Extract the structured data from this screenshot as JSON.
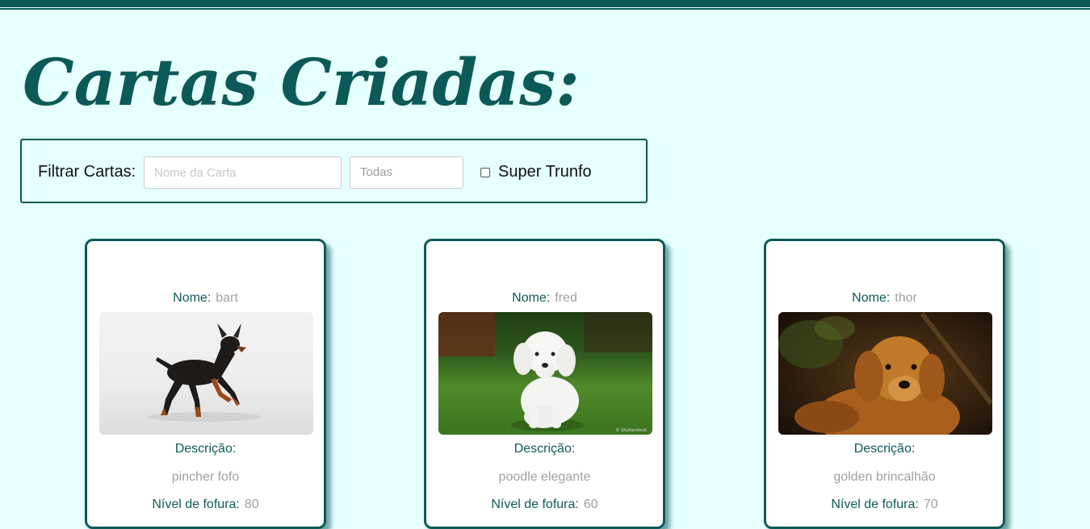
{
  "header": {
    "title": "Cartas Criadas:"
  },
  "filter": {
    "label": "Filtrar Cartas:",
    "name_placeholder": "Nome da Carta",
    "name_value": "",
    "rarity_value": "Todas",
    "trunfo_label": "Super Trunfo",
    "trunfo_checked": false
  },
  "labels": {
    "name": "Nome:",
    "description": "Descrição:",
    "attr1": "Nível de fofura:"
  },
  "cards": [
    {
      "name": "bart",
      "description": "pincher fofo",
      "attr1": "80",
      "image": "black-and-tan-miniature-pinscher-photo"
    },
    {
      "name": "fred",
      "description": "poodle elegante",
      "attr1": "60",
      "image": "white-poodle-on-grass-photo"
    },
    {
      "name": "thor",
      "description": "golden brincalhão",
      "attr1": "70",
      "image": "golden-retriever-photo"
    }
  ],
  "colors": {
    "primary": "#0c5a57",
    "background": "#e6ffff",
    "muted_text": "#a0a0a0"
  }
}
